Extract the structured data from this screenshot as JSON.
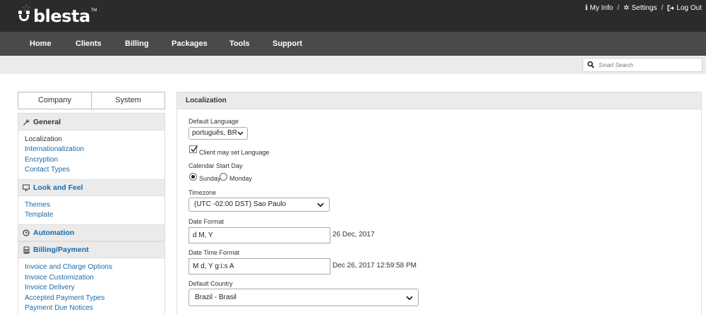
{
  "header": {
    "logo_text": "blesta",
    "logo_tm": "TM",
    "links": {
      "my_info": "My Info",
      "settings": "Settings",
      "logout": "Log Out",
      "separator": "/"
    }
  },
  "nav": {
    "items": [
      "Home",
      "Clients",
      "Billing",
      "Packages",
      "Tools",
      "Support"
    ]
  },
  "search": {
    "placeholder": "Smart Search"
  },
  "sidebar": {
    "tabs": [
      "Company",
      "System"
    ],
    "sections": {
      "general": {
        "title": "General",
        "icon": "wrench-icon",
        "items": [
          "Localization",
          "Internationalization",
          "Encryption",
          "Contact Types"
        ],
        "active": "Localization"
      },
      "look_and_feel": {
        "title": "Look and Feel",
        "icon": "monitor-icon",
        "items": [
          "Themes",
          "Template"
        ]
      },
      "automation": {
        "title": "Automation",
        "icon": "clock-icon"
      },
      "billing_payment": {
        "title": "Billing/Payment",
        "icon": "calculator-icon",
        "items": [
          "Invoice and Charge Options",
          "Invoice Customization",
          "Invoice Delivery",
          "Accepted Payment Types",
          "Payment Due Notices"
        ]
      }
    }
  },
  "content": {
    "title": "Localization",
    "default_language": {
      "label": "Default Language",
      "value": "português, BR"
    },
    "client_set_language": {
      "label": "Client may set Language",
      "checked": true
    },
    "calendar_start_day": {
      "label": "Calendar Start Day",
      "options": [
        "Sunday",
        "Monday"
      ],
      "selected": "Sunday"
    },
    "timezone": {
      "label": "Timezone",
      "value": "(UTC -02:00 DST) Sao Paulo"
    },
    "date_format": {
      "label": "Date Format",
      "value": "d M, Y",
      "preview": "26 Dec, 2017"
    },
    "date_time_format": {
      "label": "Date Time Format",
      "value": "M d, Y g:i:s A",
      "preview": "Dec 26, 2017 12:59:58 PM"
    },
    "default_country": {
      "label": "Default Country",
      "value": "Brazil - Brasil"
    }
  },
  "colors": {
    "topbar": "#2b2b2b",
    "navbar": "#4a4a4a",
    "link": "#1a6aa8",
    "subbar": "#ebebeb"
  }
}
